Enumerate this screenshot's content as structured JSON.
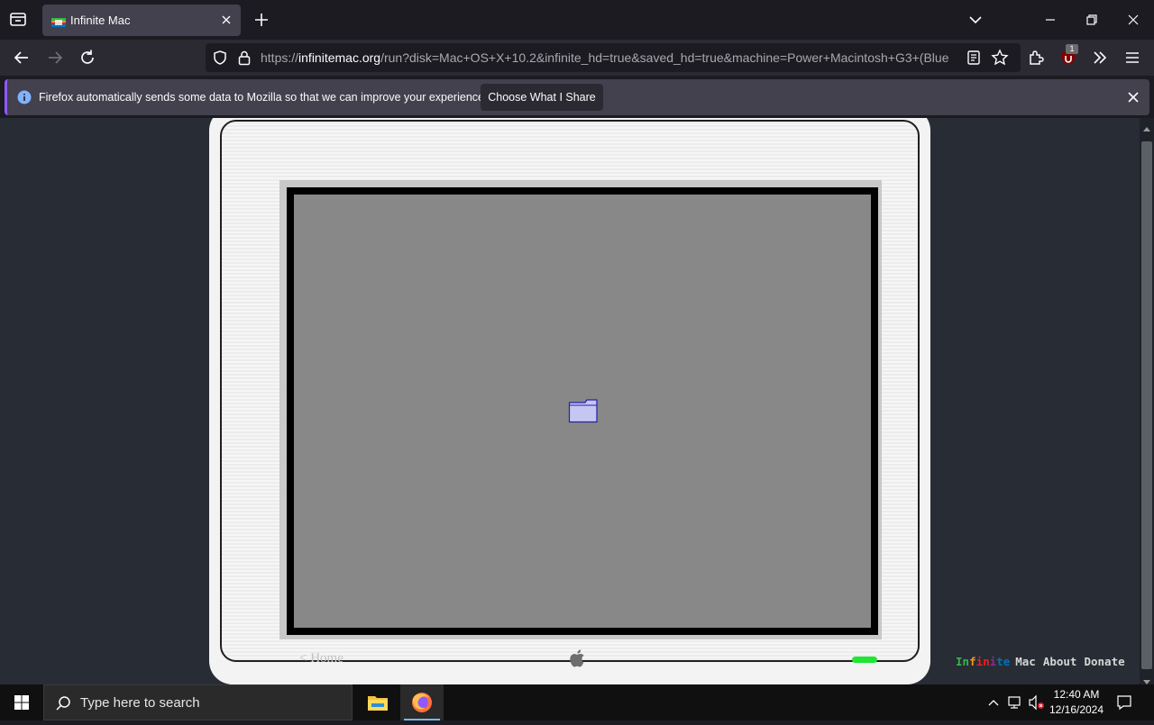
{
  "browser": {
    "tab": {
      "title": "Infinite Mac"
    },
    "url": {
      "prefix": "https://",
      "host": "infinitemac.org",
      "path": "/run?disk=Mac+OS+X+10.2&infinite_hd=true&saved_hd=true&machine=Power+Macintosh+G3+(Blue"
    },
    "extension_badge": "1",
    "notification": {
      "message": "Firefox automatically sends some data to Mozilla so that we can improve your experience.",
      "button_label": "Choose What I Share"
    }
  },
  "page": {
    "home_link": "< Home",
    "footer": {
      "infinite_letters": [
        "I",
        "n",
        "f",
        "i",
        "n",
        "i",
        "t",
        "e"
      ],
      "infinite_colors": [
        "#39b54a",
        "#39b54a",
        "#f7941d",
        "#ed1c24",
        "#ed1c24",
        "#92278f",
        "#0072bc",
        "#0072bc"
      ],
      "mac": "Mac",
      "about": "About",
      "donate": "Donate"
    },
    "power_led_color": "#1ee632"
  },
  "taskbar": {
    "search_placeholder": "Type here to search",
    "time": "12:40 AM",
    "date": "12/16/2024"
  }
}
